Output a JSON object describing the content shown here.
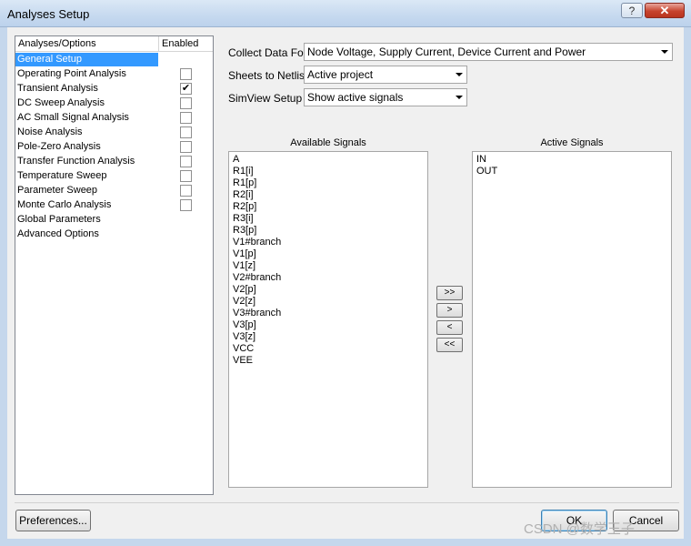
{
  "window": {
    "title": "Analyses Setup",
    "help_label": "?",
    "close_label": "✕"
  },
  "analyses": {
    "header_name": "Analyses/Options",
    "header_enabled": "Enabled",
    "items": [
      {
        "label": "General Setup",
        "selected": true,
        "has_checkbox": false
      },
      {
        "label": "Operating Point Analysis",
        "has_checkbox": true,
        "checked": ""
      },
      {
        "label": "Transient Analysis",
        "has_checkbox": true,
        "checked": "✔"
      },
      {
        "label": "DC Sweep Analysis",
        "has_checkbox": true,
        "checked": ""
      },
      {
        "label": "AC Small Signal Analysis",
        "has_checkbox": true,
        "checked": ""
      },
      {
        "label": "Noise Analysis",
        "has_checkbox": true,
        "checked": ""
      },
      {
        "label": "Pole-Zero Analysis",
        "has_checkbox": true,
        "checked": ""
      },
      {
        "label": "Transfer Function Analysis",
        "has_checkbox": true,
        "checked": ""
      },
      {
        "label": "Temperature Sweep",
        "has_checkbox": true,
        "checked": ""
      },
      {
        "label": "Parameter Sweep",
        "has_checkbox": true,
        "checked": ""
      },
      {
        "label": "Monte Carlo Analysis",
        "has_checkbox": true,
        "checked": ""
      },
      {
        "label": "Global Parameters",
        "has_checkbox": false
      },
      {
        "label": "Advanced Options",
        "has_checkbox": false
      }
    ]
  },
  "form": {
    "collect_label": "Collect Data For",
    "collect_value": "Node Voltage, Supply Current, Device Current and Power",
    "sheets_label": "Sheets to Netlist",
    "sheets_value": "Active project",
    "simview_label": "SimView Setup",
    "simview_value": "Show active signals"
  },
  "signals": {
    "available_title": "Available Signals",
    "available": [
      "A",
      "R1[i]",
      "R1[p]",
      "R2[i]",
      "R2[p]",
      "R3[i]",
      "R3[p]",
      "V1#branch",
      "V1[p]",
      "V1[z]",
      "V2#branch",
      "V2[p]",
      "V2[z]",
      "V3#branch",
      "V3[p]",
      "V3[z]",
      "VCC",
      "VEE"
    ],
    "active_title": "Active Signals",
    "active": [
      "IN",
      "OUT"
    ],
    "buttons": {
      "add_all": ">>",
      "add": ">",
      "remove": "<",
      "remove_all": "<<"
    }
  },
  "footer": {
    "preferences_label": "Preferences...",
    "ok_label": "OK",
    "cancel_label": "Cancel"
  },
  "watermark": "CSDN @数学王子"
}
